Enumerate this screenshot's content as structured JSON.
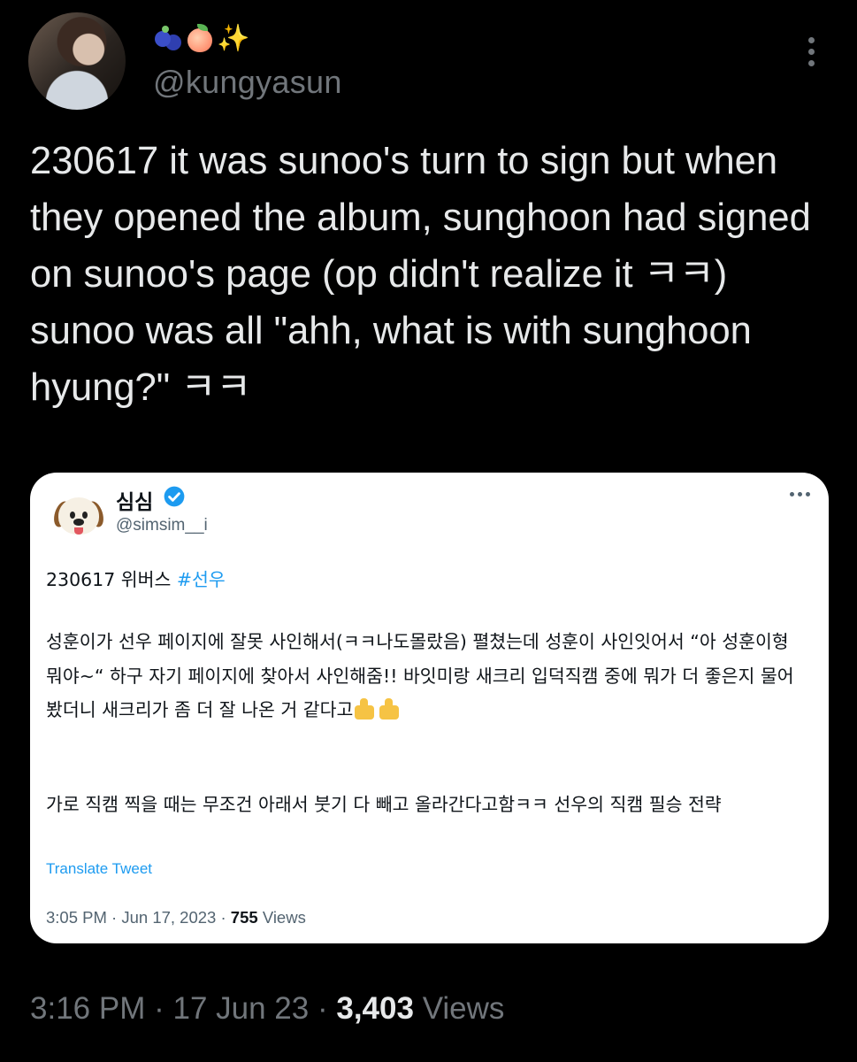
{
  "author": {
    "display_name_icons": [
      "blueberry-icon",
      "peach-icon",
      "sparkles-icon"
    ],
    "handle": "@kungyasun"
  },
  "tweet": {
    "text": "230617 it was sunoo's turn to sign but when they opened the album, sunghoon had signed on sunoo's page (op didn't realize it ㅋㅋ) sunoo was all \"ahh, what is with sunghoon hyung?\" ㅋㅋ",
    "time": "3:16 PM",
    "date": "17 Jun 23",
    "separator": "·",
    "views_count": "3,403",
    "views_label": "Views"
  },
  "quoted": {
    "display_name": "심심",
    "verified": true,
    "handle": "@simsim__i",
    "line1_prefix": "230617 위버스 ",
    "hashtag": "#선우",
    "paragraph1": "성훈이가 선우 페이지에 잘못 사인해서(ㅋㅋ나도몰랐음) 펼쳤는데 성훈이 사인잇어서 “아 성훈이형 뭐야~“ 하구 자기 페이지에 찾아서 사인해줌!! 바잇미랑 새크리 입덕직캠 중에 뭐가 더 좋은지 물어봤더니 새크리가 좀 더 잘 나온 거 같다고",
    "paragraph1_emojis": [
      "thumbs-up-icon",
      "thumbs-up-icon"
    ],
    "paragraph2": "가로 직캠 찍을 때는 무조건 아래서 붓기 다 빼고 올라간다고함ㅋㅋ 선우의 직캠 필승 전략",
    "translate_label": "Translate Tweet",
    "time": "3:05 PM",
    "date": "Jun 17, 2023",
    "separator": "·",
    "views_count": "755",
    "views_label": "Views"
  },
  "colors": {
    "background": "#000000",
    "text_primary": "#e7e9ea",
    "text_secondary": "#71767b",
    "link": "#1d9bf0",
    "card_background": "#ffffff"
  }
}
